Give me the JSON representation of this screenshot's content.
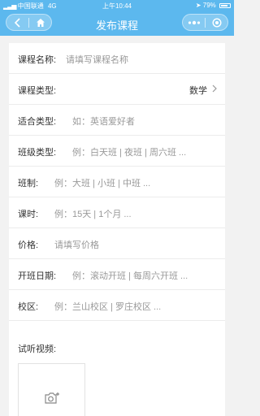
{
  "statusbar": {
    "carrier": "中国联通",
    "network": "4G",
    "time": "上午10:44",
    "battery": "79%",
    "battery_level": 0.79
  },
  "navbar": {
    "title": "发布课程",
    "back_icon": "chevron-left-icon",
    "home_icon": "home-icon",
    "more_icon": "more-dots-icon",
    "close_icon": "target-circle-icon"
  },
  "form": {
    "course_name": {
      "label": "课程名称:",
      "placeholder": "请填写课程名称"
    },
    "course_type": {
      "label": "课程类型:",
      "value": "数学"
    },
    "suitable_type": {
      "label": "适合类型:",
      "placeholder": "如：英语爱好者"
    },
    "class_type": {
      "label": "班级类型:",
      "placeholder": "例：白天班 | 夜班 | 周六班 ..."
    },
    "class_size": {
      "label": "班制:",
      "placeholder": "例：大班 | 小班 | 中班 ..."
    },
    "duration": {
      "label": "课时:",
      "placeholder": "例：15天 | 1个月 ..."
    },
    "price": {
      "label": "价格:",
      "placeholder": "请填写价格"
    },
    "start_date": {
      "label": "开班日期:",
      "placeholder": "例：滚动开班 | 每周六开班 ..."
    },
    "campus": {
      "label": "校区:",
      "placeholder": "例：兰山校区 | 罗庄校区 ..."
    },
    "trial_video": {
      "label": "试听视频:"
    }
  },
  "colors": {
    "accent": "#5cb8ee",
    "background": "#f2f2f2",
    "placeholder": "#999999",
    "text": "#333333"
  }
}
